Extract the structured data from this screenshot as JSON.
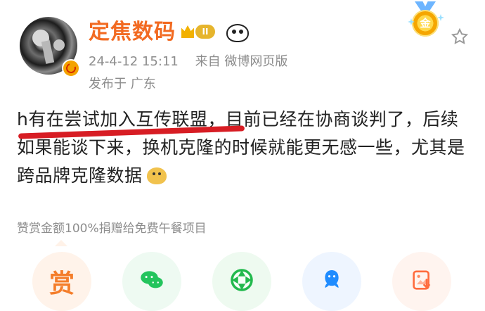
{
  "post": {
    "username": "定焦数码",
    "vip_level": "II",
    "date": "24-4-12 15:11",
    "source": "来自 微博网页版",
    "location": "发布于 广东",
    "content": "h有在尝试加入互传联盟，目前已经在协商谈判了，后续如果能谈下来，换机克隆的时候就能更无感一些，尤其是跨品牌克隆数据"
  },
  "medal": {
    "label": "金"
  },
  "reward": {
    "text": "赞赏金额100%捐赠给免费午餐项目",
    "button_label": "赏"
  },
  "icons": {
    "avatar": "user-avatar",
    "verified": "verified-badge",
    "vip": "crown-icon",
    "emoji": "panda-icon",
    "favorite": "star-icon",
    "share_wechat": "wechat-icon",
    "share_moments": "moments-icon",
    "share_qq": "qq-icon",
    "save_image": "image-save-icon"
  },
  "colors": {
    "username": "#f26a21",
    "meta": "#8c8c8c",
    "underline": "#d71d24",
    "reward": "#f47d2a",
    "wechat": "#23c45d",
    "qq": "#1f8cff"
  }
}
